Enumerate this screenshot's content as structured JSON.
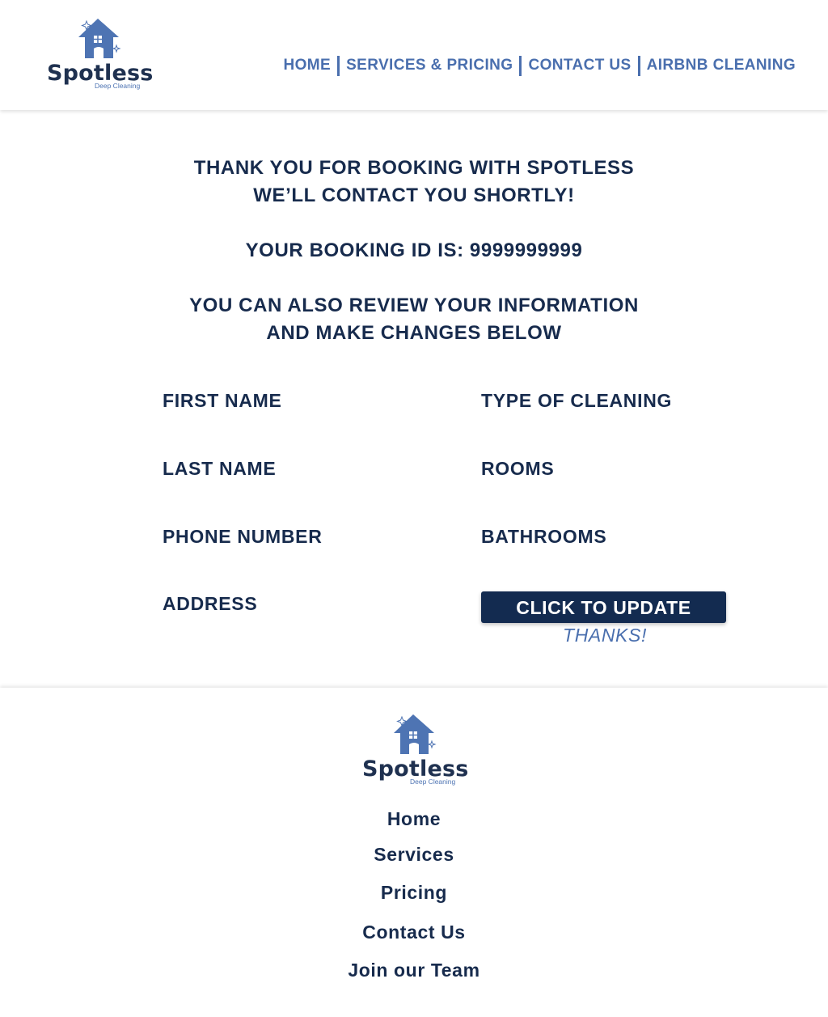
{
  "brand": {
    "name": "Spotless",
    "tagline": "Deep Cleaning",
    "logo_icon": "house-sparkle-icon",
    "colors": {
      "primary": "#4a6fae",
      "dark": "#172b4d",
      "button": "#132b50"
    }
  },
  "nav": {
    "items": [
      {
        "label": "HOME"
      },
      {
        "label": "SERVICES & PRICING"
      },
      {
        "label": "CONTACT US"
      },
      {
        "label": "AIRBNB CLEANING"
      }
    ]
  },
  "confirmation": {
    "line1": "THANK YOU FOR BOOKING WITH SPOTLESS",
    "line2": "WE’LL CONTACT YOU SHORTLY!",
    "booking_id": "YOUR BOOKING ID IS: 9999999999",
    "review_line1": "YOU CAN ALSO REVIEW YOUR INFORMATION",
    "review_line2": "AND MAKE CHANGES BELOW"
  },
  "form": {
    "left_fields": [
      {
        "label": "FIRST NAME"
      },
      {
        "label": "LAST NAME"
      },
      {
        "label": "PHONE NUMBER"
      },
      {
        "label": "ADDRESS"
      }
    ],
    "right_fields": [
      {
        "label": "TYPE OF CLEANING"
      },
      {
        "label": "ROOMS"
      },
      {
        "label": "BATHROOMS"
      }
    ],
    "update_button": "CLICK TO UPDATE",
    "thanks": "THANKS!"
  },
  "footer": {
    "links": [
      {
        "label": "Home"
      },
      {
        "label": "Services"
      },
      {
        "label": "Pricing"
      },
      {
        "label": "Contact Us"
      },
      {
        "label": "Join our Team"
      }
    ]
  }
}
